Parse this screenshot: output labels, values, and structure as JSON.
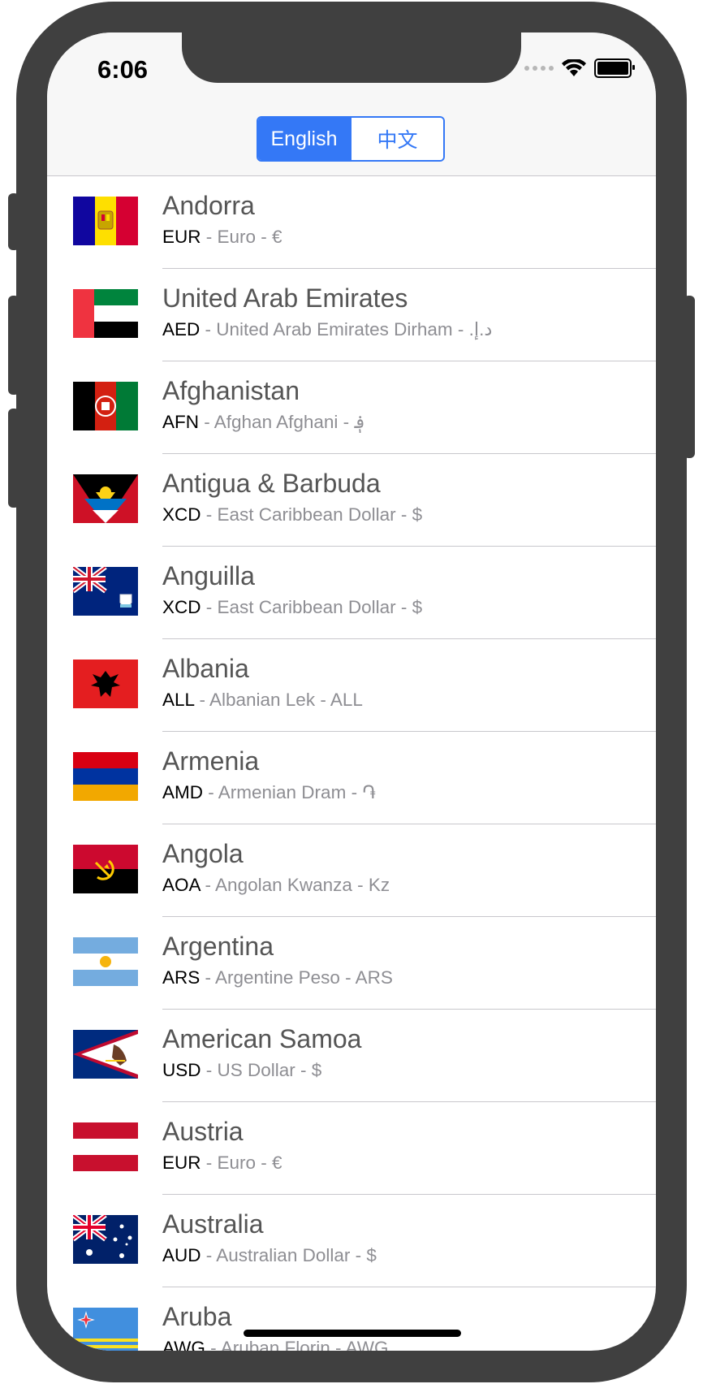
{
  "status_bar": {
    "time": "6:06"
  },
  "segmented": {
    "options": [
      "English",
      "中文"
    ],
    "selected": "English"
  },
  "countries": [
    {
      "name": "Andorra",
      "code": "EUR",
      "currency": "Euro",
      "symbol": "€",
      "flag_icon": "andorra-flag-icon"
    },
    {
      "name": "United Arab Emirates",
      "code": "AED",
      "currency": "United Arab Emirates Dirham",
      "symbol": "د.إ.‏",
      "flag_icon": "uae-flag-icon"
    },
    {
      "name": "Afghanistan",
      "code": "AFN",
      "currency": "Afghan Afghani",
      "symbol": "؋",
      "flag_icon": "afghanistan-flag-icon"
    },
    {
      "name": "Antigua & Barbuda",
      "code": "XCD",
      "currency": "East Caribbean Dollar",
      "symbol": "$",
      "flag_icon": "antigua-flag-icon"
    },
    {
      "name": "Anguilla",
      "code": "XCD",
      "currency": "East Caribbean Dollar",
      "symbol": "$",
      "flag_icon": "anguilla-flag-icon"
    },
    {
      "name": "Albania",
      "code": "ALL",
      "currency": "Albanian Lek",
      "symbol": "ALL",
      "flag_icon": "albania-flag-icon"
    },
    {
      "name": "Armenia",
      "code": "AMD",
      "currency": "Armenian Dram",
      "symbol": "֏",
      "flag_icon": "armenia-flag-icon"
    },
    {
      "name": "Angola",
      "code": "AOA",
      "currency": "Angolan Kwanza",
      "symbol": "Kz",
      "flag_icon": "angola-flag-icon"
    },
    {
      "name": "Argentina",
      "code": "ARS",
      "currency": "Argentine Peso",
      "symbol": "ARS",
      "flag_icon": "argentina-flag-icon"
    },
    {
      "name": "American Samoa",
      "code": "USD",
      "currency": "US Dollar",
      "symbol": "$",
      "flag_icon": "american-samoa-flag-icon"
    },
    {
      "name": "Austria",
      "code": "EUR",
      "currency": "Euro",
      "symbol": "€",
      "flag_icon": "austria-flag-icon"
    },
    {
      "name": "Australia",
      "code": "AUD",
      "currency": "Australian Dollar",
      "symbol": "$",
      "flag_icon": "australia-flag-icon"
    },
    {
      "name": "Aruba",
      "code": "AWG",
      "currency": "Aruban Florin",
      "symbol": "AWG",
      "flag_icon": "aruba-flag-icon"
    }
  ],
  "colors": {
    "accent": "#3478f6",
    "frame": "#404040",
    "separator": "#c8c7cc"
  }
}
